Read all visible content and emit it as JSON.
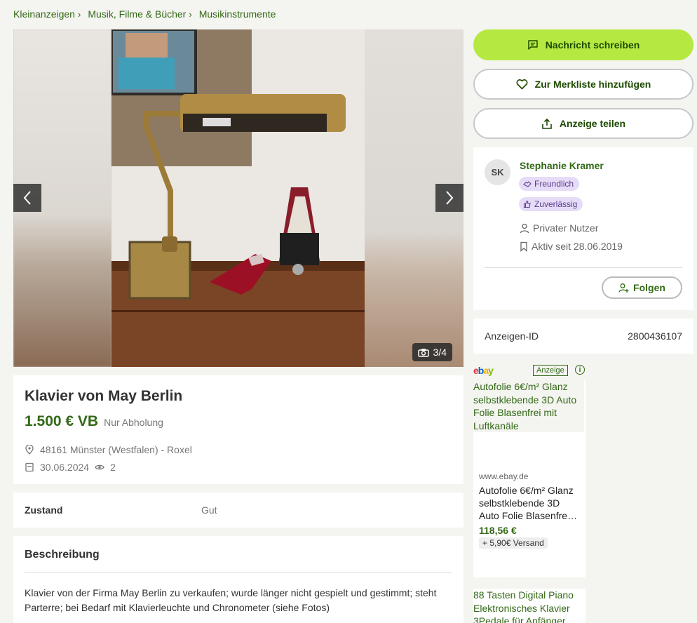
{
  "breadcrumb": [
    {
      "label": "Kleinanzeigen"
    },
    {
      "label": "Musik, Filme & Bücher"
    },
    {
      "label": "Musikinstrumente"
    }
  ],
  "gallery": {
    "counter": "3/4"
  },
  "listing": {
    "title": "Klavier von May Berlin",
    "price": "1.500 € VB",
    "pickup": "Nur Abholung",
    "location": "48161 Münster (Westfalen) - Roxel",
    "date": "30.06.2024",
    "views": "2"
  },
  "details": {
    "state_key": "Zustand",
    "state_value": "Gut"
  },
  "description": {
    "heading": "Beschreibung",
    "text": "Klavier von der Firma May Berlin zu verkaufen; wurde länger nicht gespielt und gestimmt; steht Parterre; bei Bedarf mit Klavierleuchte und Chronometer (siehe Fotos)"
  },
  "actions": {
    "message": "Nachricht schreiben",
    "watchlist": "Zur Merkliste hinzufügen",
    "share": "Anzeige teilen"
  },
  "seller": {
    "initials": "SK",
    "name": "Stephanie Kramer",
    "badge1": "Freundlich",
    "badge2": "Zuverlässig",
    "type": "Privater Nutzer",
    "active_since": "Aktiv seit 28.06.2019",
    "follow": "Folgen"
  },
  "ad_id": {
    "label": "Anzeigen-ID",
    "value": "2800436107"
  },
  "ad": {
    "label": "Anzeige",
    "title": "Autofolie 6€/m² Glanz selbstklebende 3D Auto Folie Blasenfrei mit Luftkanäle",
    "domain": "www.ebay.de",
    "desc": "Autofolie 6€/m² Glanz selbstklebende 3D Auto Folie Blasenfre…",
    "price": "118,56 €",
    "shipping": "+ 5,90€ Versand"
  },
  "ad2": {
    "title": "88 Tasten Digital Piano Elektronisches Klavier 3Pedale für Anfänger"
  },
  "colors": {
    "accent": "#326916",
    "primary_button": "#b5e941"
  }
}
